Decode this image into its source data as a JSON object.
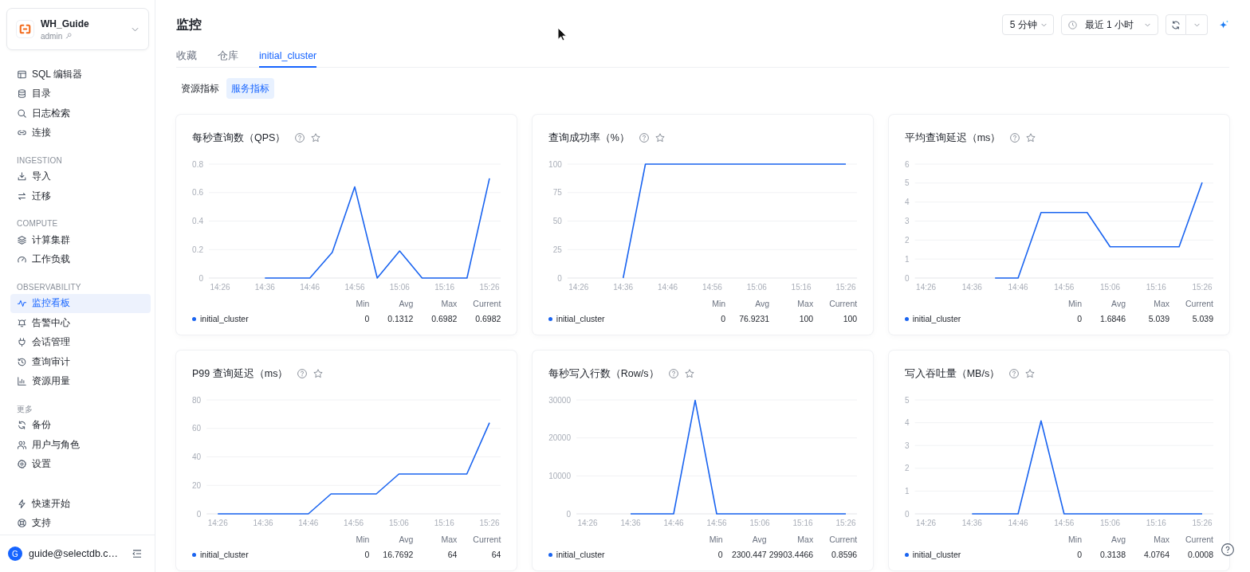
{
  "sidebar": {
    "workspace": {
      "name": "WH_Guide",
      "role": "admin"
    },
    "nav_groups": [
      {
        "items": [
          {
            "label": "SQL 编辑器",
            "selected": false
          },
          {
            "label": "目录",
            "selected": false
          },
          {
            "label": "日志检索",
            "selected": false
          },
          {
            "label": "连接",
            "selected": false
          }
        ]
      },
      {
        "heading": "INGESTION",
        "items": [
          {
            "label": "导入",
            "selected": false
          },
          {
            "label": "迁移",
            "selected": false
          }
        ]
      },
      {
        "heading": "COMPUTE",
        "items": [
          {
            "label": "计算集群",
            "selected": false
          },
          {
            "label": "工作负载",
            "selected": false
          }
        ]
      },
      {
        "heading": "OBSERVABILITY",
        "items": [
          {
            "label": "监控看板",
            "selected": true
          },
          {
            "label": "告警中心",
            "selected": false
          },
          {
            "label": "会话管理",
            "selected": false
          },
          {
            "label": "查询审计",
            "selected": false
          },
          {
            "label": "资源用量",
            "selected": false
          }
        ]
      },
      {
        "heading": "更多",
        "items": [
          {
            "label": "备份",
            "selected": false
          },
          {
            "label": "用户与角色",
            "selected": false
          },
          {
            "label": "设置",
            "selected": false
          }
        ]
      }
    ],
    "footer_items": [
      {
        "label": "快速开始",
        "selected": false
      },
      {
        "label": "支持",
        "selected": false
      }
    ],
    "user": {
      "avatar_letter": "G",
      "email": "guide@selectdb.c…"
    }
  },
  "header": {
    "title": "监控",
    "interval": "5 分钟",
    "time_range": "最近 1 小时"
  },
  "tabs": [
    {
      "label": "收藏",
      "selected": false
    },
    {
      "label": "仓库",
      "selected": false
    },
    {
      "label": "initial_cluster",
      "selected": true
    }
  ],
  "sub_tabs": [
    {
      "label": "资源指标",
      "selected": false
    },
    {
      "label": "服务指标",
      "selected": true
    }
  ],
  "panels": [
    {
      "title": "每秒查询数（QPS）",
      "legend": {
        "columns": [
          "Min",
          "Avg",
          "Max",
          "Current"
        ],
        "rows": [
          [
            "0",
            "0.1312",
            "0.6982",
            "0.6982"
          ]
        ]
      },
      "chart_data": {
        "type": "line",
        "grid": true,
        "categories": [
          "14:26",
          null,
          "14:36",
          null,
          "14:46",
          null,
          "14:56",
          null,
          "15:06",
          null,
          "15:16",
          null,
          "15:26"
        ],
        "ylim": [
          0,
          0.8
        ],
        "yticks": [
          0,
          0.2,
          0.4,
          0.6,
          0.8
        ],
        "series": [
          {
            "name": "initial_cluster",
            "color": "#1a64f0",
            "values": [
              null,
              null,
              0,
              0,
              0,
              0.18,
              0.64,
              0,
              0.19,
              0,
              0,
              0,
              0.7
            ]
          }
        ]
      }
    },
    {
      "title": "查询成功率（%）",
      "legend": {
        "columns": [
          "Min",
          "Avg",
          "Max",
          "Current"
        ],
        "rows": [
          [
            "0",
            "76.9231",
            "100",
            "100"
          ]
        ]
      },
      "chart_data": {
        "type": "line",
        "grid": true,
        "categories": [
          "14:26",
          null,
          "14:36",
          null,
          "14:46",
          null,
          "14:56",
          null,
          "15:06",
          null,
          "15:16",
          null,
          "15:26"
        ],
        "ylim": [
          0,
          100
        ],
        "yticks": [
          0,
          25,
          50,
          75,
          100
        ],
        "series": [
          {
            "name": "initial_cluster",
            "color": "#1a64f0",
            "values": [
              null,
              null,
              0,
              100,
              100,
              100,
              100,
              100,
              100,
              100,
              100,
              100,
              100
            ]
          }
        ]
      }
    },
    {
      "title": "平均查询延迟（ms）",
      "legend": {
        "columns": [
          "Min",
          "Avg",
          "Max",
          "Current"
        ],
        "rows": [
          [
            "0",
            "1.6846",
            "5.039",
            "5.039"
          ]
        ]
      },
      "chart_data": {
        "type": "line",
        "grid": true,
        "categories": [
          "14:26",
          null,
          "14:36",
          null,
          "14:46",
          null,
          "14:56",
          null,
          "15:06",
          null,
          "15:16",
          null,
          "15:26"
        ],
        "ylim": [
          0,
          6
        ],
        "yticks": [
          0,
          1,
          2,
          3,
          4,
          5,
          6
        ],
        "series": [
          {
            "name": "initial_cluster",
            "color": "#1a64f0",
            "values": [
              null,
              null,
              null,
              0,
              0,
              3.45,
              3.45,
              3.45,
              1.65,
              1.65,
              1.65,
              1.65,
              5.04
            ]
          }
        ]
      }
    },
    {
      "title": "P99 查询延迟（ms）",
      "legend": {
        "columns": [
          "Min",
          "Avg",
          "Max",
          "Current"
        ],
        "rows": [
          [
            "0",
            "16.7692",
            "64",
            "64"
          ]
        ]
      },
      "chart_data": {
        "type": "line",
        "grid": true,
        "categories": [
          "14:26",
          null,
          "14:36",
          null,
          "14:46",
          null,
          "14:56",
          null,
          "15:06",
          null,
          "15:16",
          null,
          "15:26"
        ],
        "ylim": [
          0,
          80
        ],
        "yticks": [
          0,
          20,
          40,
          60,
          80
        ],
        "series": [
          {
            "name": "initial_cluster",
            "color": "#1a64f0",
            "values": [
              0,
              0,
              0,
              0,
              0,
              14,
              14,
              14,
              28,
              28,
              28,
              28,
              64
            ]
          }
        ]
      }
    },
    {
      "title": "每秒写入行数（Row/s）",
      "legend": {
        "columns": [
          "Min",
          "Avg",
          "Max",
          "Current"
        ],
        "rows": [
          [
            "0",
            "2300.447",
            "29903.4466",
            "0.8596"
          ]
        ]
      },
      "chart_data": {
        "type": "line",
        "grid": true,
        "categories": [
          "14:26",
          null,
          "14:36",
          null,
          "14:46",
          null,
          "14:56",
          null,
          "15:06",
          null,
          "15:16",
          null,
          "15:26"
        ],
        "ylim": [
          0,
          30000
        ],
        "yticks": [
          0,
          10000,
          20000,
          30000
        ],
        "series": [
          {
            "name": "initial_cluster",
            "color": "#1a64f0",
            "values": [
              null,
              null,
              0,
              0,
              0,
              29900,
              0,
              0,
              0,
              0,
              0,
              0,
              0
            ]
          }
        ]
      }
    },
    {
      "title": "写入吞吐量（MB/s）",
      "legend": {
        "columns": [
          "Min",
          "Avg",
          "Max",
          "Current"
        ],
        "rows": [
          [
            "0",
            "0.3138",
            "4.0764",
            "0.0008"
          ]
        ]
      },
      "chart_data": {
        "type": "line",
        "grid": true,
        "categories": [
          "14:26",
          null,
          "14:36",
          null,
          "14:46",
          null,
          "14:56",
          null,
          "15:06",
          null,
          "15:16",
          null,
          "15:26"
        ],
        "ylim": [
          0,
          5
        ],
        "yticks": [
          0,
          1,
          2,
          3,
          4,
          5
        ],
        "series": [
          {
            "name": "initial_cluster",
            "color": "#1a64f0",
            "values": [
              null,
              null,
              0,
              0,
              0,
              4.08,
              0,
              0,
              0,
              0,
              0,
              0,
              0
            ]
          }
        ]
      }
    }
  ]
}
